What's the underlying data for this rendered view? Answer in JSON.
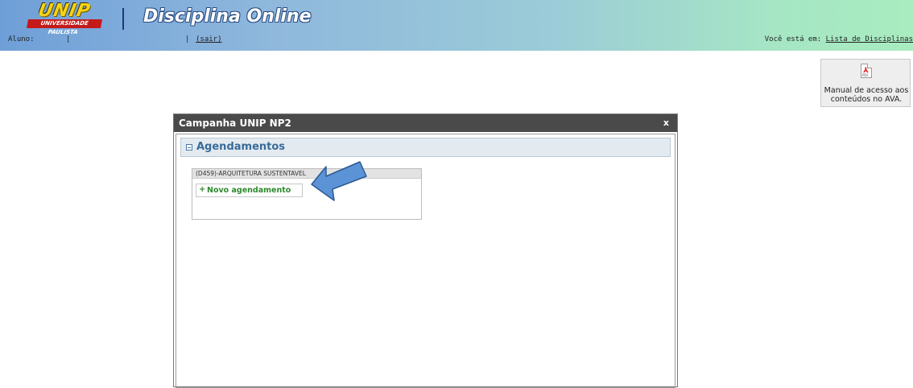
{
  "header": {
    "logo_text": "UNIP",
    "logo_tagline": "UNIVERSIDADE PAULISTA",
    "app_title": "Disciplina Online",
    "aluno_label": "Aluno:",
    "separator": "|",
    "sair_label": "(sair)",
    "breadcrumb_prefix": "Você está em:",
    "breadcrumb_link": "Lista de Disciplinas"
  },
  "manual_button": {
    "icon": "pdf-icon",
    "icon_mark": "⅄",
    "icon_label": "PDF",
    "label": "Manual de acesso aos conteúdos no AVA."
  },
  "modal": {
    "title": "Campanha UNIP NP2",
    "close_label": "x",
    "section_title": "Agendamentos",
    "card": {
      "title": "(D459)-ARQUITETURA SUSTENTAVEL",
      "new_button_plus": "+",
      "new_button_label": "Novo agendamento"
    }
  },
  "colors": {
    "header_start": "#6f9fd8",
    "header_end": "#a8ecc0",
    "modal_titlebar": "#4a4a4a",
    "accent_blue": "#3a6b9a",
    "action_green": "#2e8a2e",
    "arrow_fill": "#5b93d6"
  }
}
